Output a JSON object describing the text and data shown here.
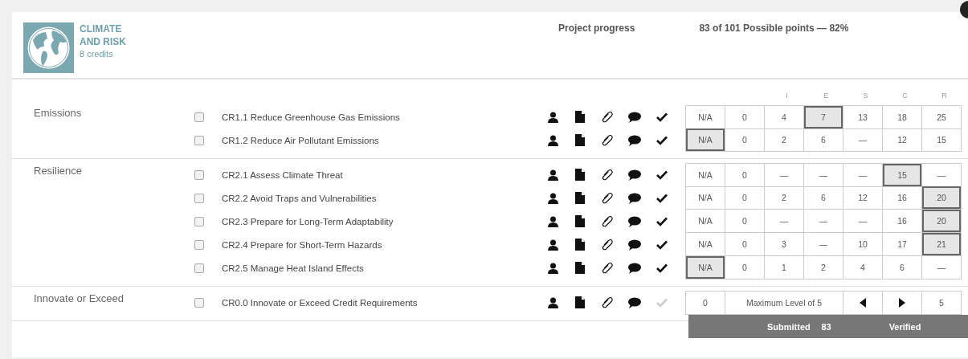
{
  "category": {
    "title": "CLIMATE AND RISK",
    "credits": "8 credits"
  },
  "progress_label": "Project progress",
  "points_summary": "83 of 101 Possible points — 82%",
  "level_headers": [
    "I",
    "E",
    "S",
    "C",
    "R"
  ],
  "groups": [
    {
      "name": "Emissions",
      "credits": [
        {
          "kind": "scored",
          "title": "CR1.1 Reduce Greenhouse Gas Emissions",
          "checked": false,
          "verified": true,
          "cells": [
            {
              "text": "N/A",
              "selected": false
            },
            {
              "text": "0",
              "selected": false
            },
            {
              "text": "4",
              "selected": false
            },
            {
              "text": "7",
              "selected": true
            },
            {
              "text": "13",
              "selected": false
            },
            {
              "text": "18",
              "selected": false
            },
            {
              "text": "25",
              "selected": false
            }
          ]
        },
        {
          "kind": "scored",
          "title": "CR1.2 Reduce Air Pollutant Emissions",
          "checked": false,
          "verified": true,
          "cells": [
            {
              "text": "N/A",
              "selected": true
            },
            {
              "text": "0",
              "selected": false
            },
            {
              "text": "2",
              "selected": false
            },
            {
              "text": "6",
              "selected": false
            },
            {
              "text": "—",
              "selected": false
            },
            {
              "text": "12",
              "selected": false
            },
            {
              "text": "15",
              "selected": false
            }
          ]
        }
      ]
    },
    {
      "name": "Resilience",
      "credits": [
        {
          "kind": "scored",
          "title": "CR2.1 Assess Climate Threat",
          "checked": false,
          "verified": true,
          "cells": [
            {
              "text": "N/A",
              "selected": false
            },
            {
              "text": "0",
              "selected": false
            },
            {
              "text": "—",
              "selected": false
            },
            {
              "text": "—",
              "selected": false
            },
            {
              "text": "—",
              "selected": false
            },
            {
              "text": "15",
              "selected": true
            },
            {
              "text": "—",
              "selected": false
            }
          ]
        },
        {
          "kind": "scored",
          "title": "CR2.2 Avoid Traps and Vulnerabilities",
          "checked": false,
          "verified": true,
          "cells": [
            {
              "text": "N/A",
              "selected": false
            },
            {
              "text": "0",
              "selected": false
            },
            {
              "text": "2",
              "selected": false
            },
            {
              "text": "6",
              "selected": false
            },
            {
              "text": "12",
              "selected": false
            },
            {
              "text": "16",
              "selected": false
            },
            {
              "text": "20",
              "selected": true
            }
          ]
        },
        {
          "kind": "scored",
          "title": "CR2.3 Prepare for Long-Term Adaptability",
          "checked": false,
          "verified": true,
          "cells": [
            {
              "text": "N/A",
              "selected": false
            },
            {
              "text": "0",
              "selected": false
            },
            {
              "text": "—",
              "selected": false
            },
            {
              "text": "—",
              "selected": false
            },
            {
              "text": "—",
              "selected": false
            },
            {
              "text": "16",
              "selected": false
            },
            {
              "text": "20",
              "selected": true
            }
          ]
        },
        {
          "kind": "scored",
          "title": "CR2.4 Prepare for Short-Term Hazards",
          "checked": false,
          "verified": true,
          "cells": [
            {
              "text": "N/A",
              "selected": false
            },
            {
              "text": "0",
              "selected": false
            },
            {
              "text": "3",
              "selected": false
            },
            {
              "text": "—",
              "selected": false
            },
            {
              "text": "10",
              "selected": false
            },
            {
              "text": "17",
              "selected": false
            },
            {
              "text": "21",
              "selected": true
            }
          ]
        },
        {
          "kind": "scored",
          "title": "CR2.5 Manage Heat Island Effects",
          "checked": false,
          "verified": true,
          "cells": [
            {
              "text": "N/A",
              "selected": true
            },
            {
              "text": "0",
              "selected": false
            },
            {
              "text": "1",
              "selected": false
            },
            {
              "text": "2",
              "selected": false
            },
            {
              "text": "4",
              "selected": false
            },
            {
              "text": "6",
              "selected": false
            },
            {
              "text": "—",
              "selected": false
            }
          ]
        }
      ]
    },
    {
      "name": "Innovate or Exceed",
      "credits": [
        {
          "kind": "innovation",
          "title": "CR0.0 Innovate or Exceed Credit Requirements",
          "checked": false,
          "verified": false,
          "minimum": "0",
          "level_label": "Maximum Level of 5",
          "maximum": "5"
        }
      ]
    }
  ],
  "totals": {
    "submitted_label": "Submitted",
    "submitted_value": "83",
    "verified_label": "Verified"
  }
}
